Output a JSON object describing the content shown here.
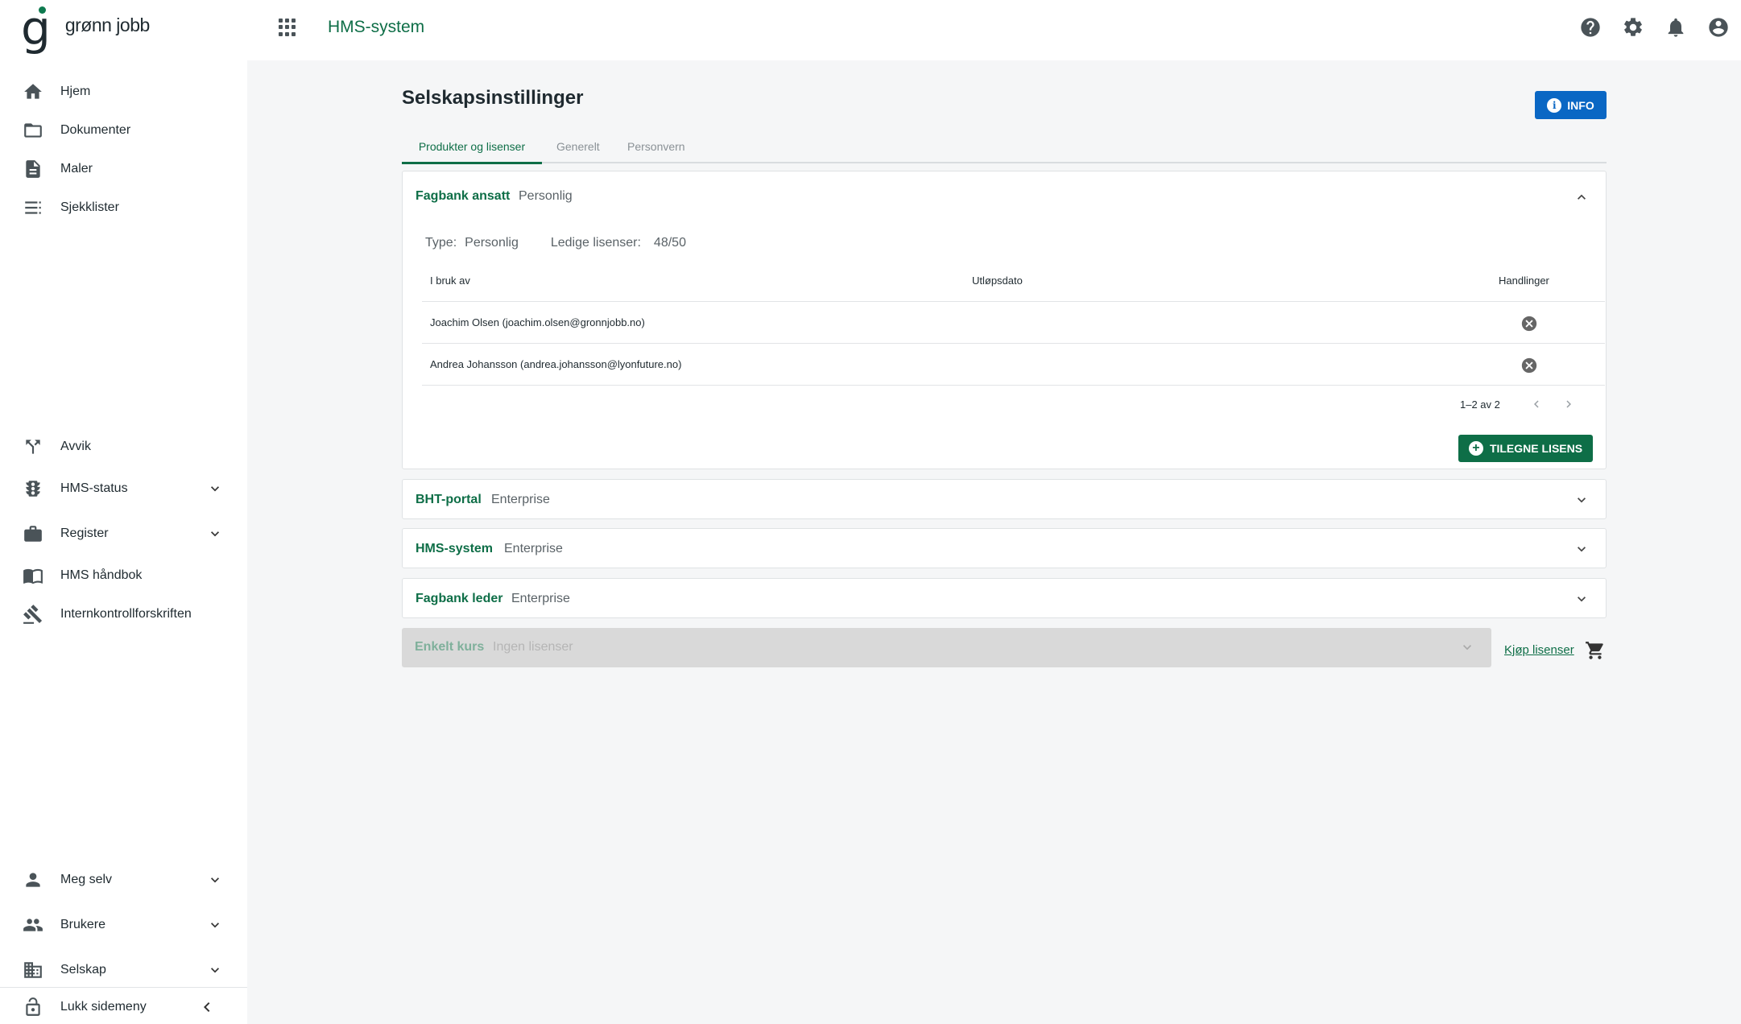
{
  "brand": {
    "logo_letter": "g",
    "name": "grønn jobb"
  },
  "header": {
    "app_title": "HMS-system"
  },
  "sidebar": {
    "items": [
      {
        "label": "Hjem",
        "icon": "home-icon"
      },
      {
        "label": "Dokumenter",
        "icon": "folder-icon"
      },
      {
        "label": "Maler",
        "icon": "document-icon"
      },
      {
        "label": "Sjekklister",
        "icon": "checklist-icon"
      },
      {
        "label": "Avvik",
        "icon": "fork-icon"
      },
      {
        "label": "HMS-status",
        "icon": "traffic-light-icon",
        "expandable": true
      },
      {
        "label": "Register",
        "icon": "briefcase-icon",
        "expandable": true
      },
      {
        "label": "HMS håndbok",
        "icon": "book-icon"
      },
      {
        "label": "Internkontrollforskriften",
        "icon": "gavel-icon"
      },
      {
        "label": "Meg selv",
        "icon": "person-icon",
        "expandable": true
      },
      {
        "label": "Brukere",
        "icon": "people-icon",
        "expandable": true
      },
      {
        "label": "Selskap",
        "icon": "building-icon",
        "expandable": true
      }
    ],
    "collapse_label": "Lukk sidemeny"
  },
  "page": {
    "title": "Selskapsinstillinger",
    "info_button": "INFO",
    "tabs": [
      {
        "label": "Produkter og lisenser",
        "active": true
      },
      {
        "label": "Generelt",
        "active": false
      },
      {
        "label": "Personvern",
        "active": false
      }
    ]
  },
  "products": {
    "expanded": {
      "name": "Fagbank ansatt",
      "type": "Personlig",
      "type_label": "Type:",
      "type_value": "Personlig",
      "licenses_label": "Ledige lisenser:",
      "licenses_value": "48/50",
      "columns": [
        "I bruk av",
        "Utløpsdato",
        "Handlinger"
      ],
      "rows": [
        {
          "user": "Joachim Olsen (joachim.olsen@gronnjobb.no)",
          "expiry": ""
        },
        {
          "user": "Andrea Johansson (andrea.johansson@lyonfuture.no)",
          "expiry": ""
        }
      ],
      "pagination": "1–2 av 2",
      "assign_button": "TILEGNE LISENS"
    },
    "collapsed": [
      {
        "name": "BHT-portal",
        "type": "Enterprise"
      },
      {
        "name": "HMS-system",
        "type": "Enterprise"
      },
      {
        "name": "Fagbank leder",
        "type": "Enterprise"
      }
    ],
    "disabled": {
      "name": "Enkelt kurs",
      "type": "Ingen lisenser"
    },
    "buy_link": "Kjøp lisenser"
  },
  "colors": {
    "brand_green": "#0e6e47",
    "info_blue": "#0a67c4",
    "background": "#f5f6f7"
  }
}
